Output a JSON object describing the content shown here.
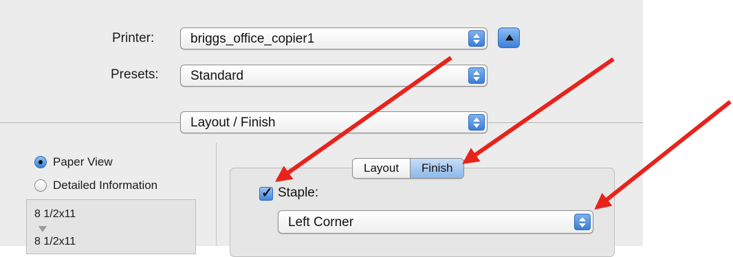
{
  "printer": {
    "label": "Printer:",
    "value": "briggs_office_copier1"
  },
  "presets": {
    "label": "Presets:",
    "value": "Standard"
  },
  "panel": {
    "value": "Layout / Finish"
  },
  "view": {
    "paper_view": "Paper View",
    "detailed_info": "Detailed Information",
    "selected": "Paper View"
  },
  "paper_list": [
    "8 1/2x11",
    "8 1/2x11"
  ],
  "tabs": {
    "layout": "Layout",
    "finish": "Finish",
    "selected": "Finish"
  },
  "staple": {
    "label": "Staple:",
    "checked": true,
    "position": "Left Corner"
  },
  "icons": [
    "disclosure-triangle-icon",
    "updown-arrow-icon",
    "checkmark-icon",
    "down-triangle-icon",
    "annotation-arrow-icon"
  ],
  "colors": {
    "accent": "#3c80d8",
    "annotation_arrow": "#e8231b",
    "dialog_bg": "#ececec"
  }
}
